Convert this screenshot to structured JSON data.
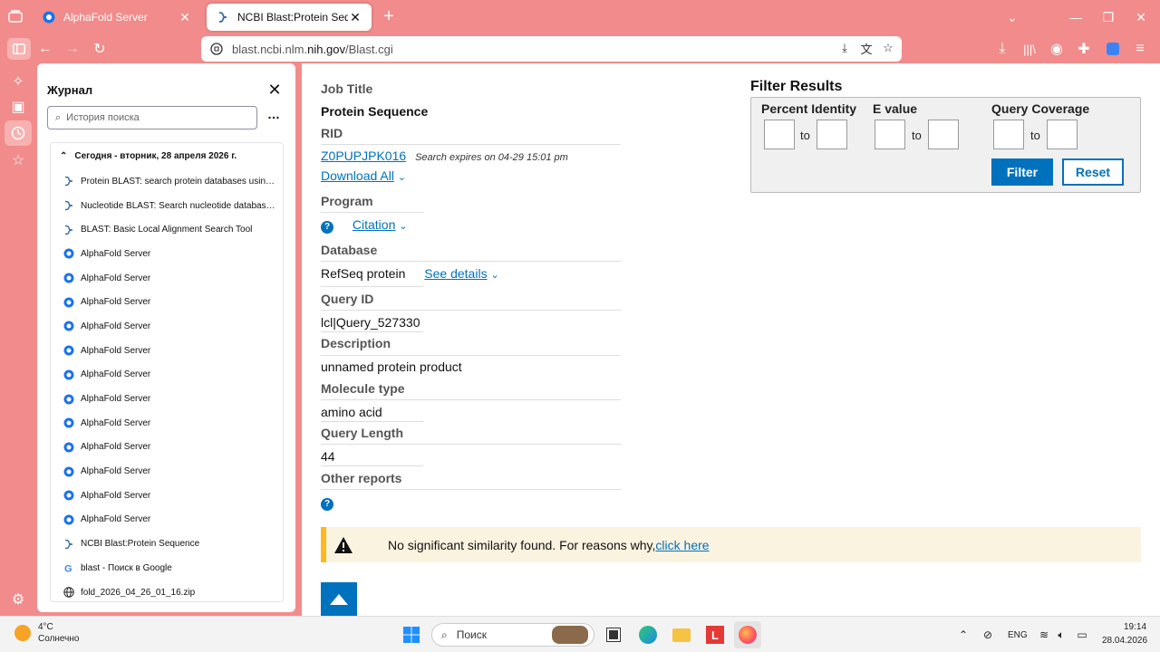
{
  "browser": {
    "tabs": [
      {
        "title": "AlphaFold Server",
        "icon": "alphafold-icon",
        "active": false
      },
      {
        "title": "NCBI Blast:Protein Sequence",
        "icon": "ncbi-icon",
        "active": true
      }
    ],
    "url_prefix": "blast.ncbi.nlm.",
    "url_domain": "nih.gov",
    "url_suffix": "/Blast.cgi",
    "accent": "#f28b8b"
  },
  "history": {
    "title": "Журнал",
    "search_placeholder": "История поиска",
    "group_label": "Сегодня - вторник, 28 апреля 2026 г.",
    "items": [
      {
        "label": "Protein BLAST: search protein databases using ...",
        "icon": "ncbi-icon"
      },
      {
        "label": "Nucleotide BLAST: Search nucleotide database...",
        "icon": "ncbi-icon"
      },
      {
        "label": "BLAST: Basic Local Alignment Search Tool",
        "icon": "ncbi-icon"
      },
      {
        "label": "AlphaFold Server",
        "icon": "alphafold-icon"
      },
      {
        "label": "AlphaFold Server",
        "icon": "alphafold-icon"
      },
      {
        "label": "AlphaFold Server",
        "icon": "alphafold-icon"
      },
      {
        "label": "AlphaFold Server",
        "icon": "alphafold-icon"
      },
      {
        "label": "AlphaFold Server",
        "icon": "alphafold-icon"
      },
      {
        "label": "AlphaFold Server",
        "icon": "alphafold-icon"
      },
      {
        "label": "AlphaFold Server",
        "icon": "alphafold-icon"
      },
      {
        "label": "AlphaFold Server",
        "icon": "alphafold-icon"
      },
      {
        "label": "AlphaFold Server",
        "icon": "alphafold-icon"
      },
      {
        "label": "AlphaFold Server",
        "icon": "alphafold-icon"
      },
      {
        "label": "AlphaFold Server",
        "icon": "alphafold-icon"
      },
      {
        "label": "AlphaFold Server",
        "icon": "alphafold-icon"
      },
      {
        "label": "NCBI Blast:Protein Sequence",
        "icon": "ncbi-icon"
      },
      {
        "label": "blast - Поиск в Google",
        "icon": "google-icon"
      },
      {
        "label": "fold_2026_04_26_01_16.zip",
        "icon": "globe-icon"
      }
    ]
  },
  "job": {
    "job_title_label": "Job Title",
    "job_title": "Protein Sequence",
    "rid_label": "RID",
    "rid": "Z0PUPJPK016",
    "expires": "Search expires on 04-29 15:01 pm",
    "download_all": "Download All",
    "program_label": "Program",
    "citation": "Citation",
    "database_label": "Database",
    "database": "RefSeq protein",
    "see_details": "See details",
    "query_id_label": "Query ID",
    "query_id": "lcl|Query_527330",
    "description_label": "Description",
    "description": "unnamed protein product",
    "molecule_type_label": "Molecule type",
    "molecule_type": "amino acid",
    "query_length_label": "Query Length",
    "query_length": "44",
    "other_reports_label": "Other reports"
  },
  "filter": {
    "title": "Filter Results",
    "percent_identity": "Percent Identity",
    "e_value": "E value",
    "query_coverage": "Query Coverage",
    "to": "to",
    "filter_button": "Filter",
    "reset_button": "Reset"
  },
  "alert": {
    "message": "No significant similarity found. For reasons why,",
    "link": "click here"
  },
  "taskbar": {
    "temperature": "4°C",
    "weather": "Солнечно",
    "search_placeholder": "Поиск",
    "language": "ENG",
    "time": "19:14",
    "date": "28.04.2026"
  }
}
